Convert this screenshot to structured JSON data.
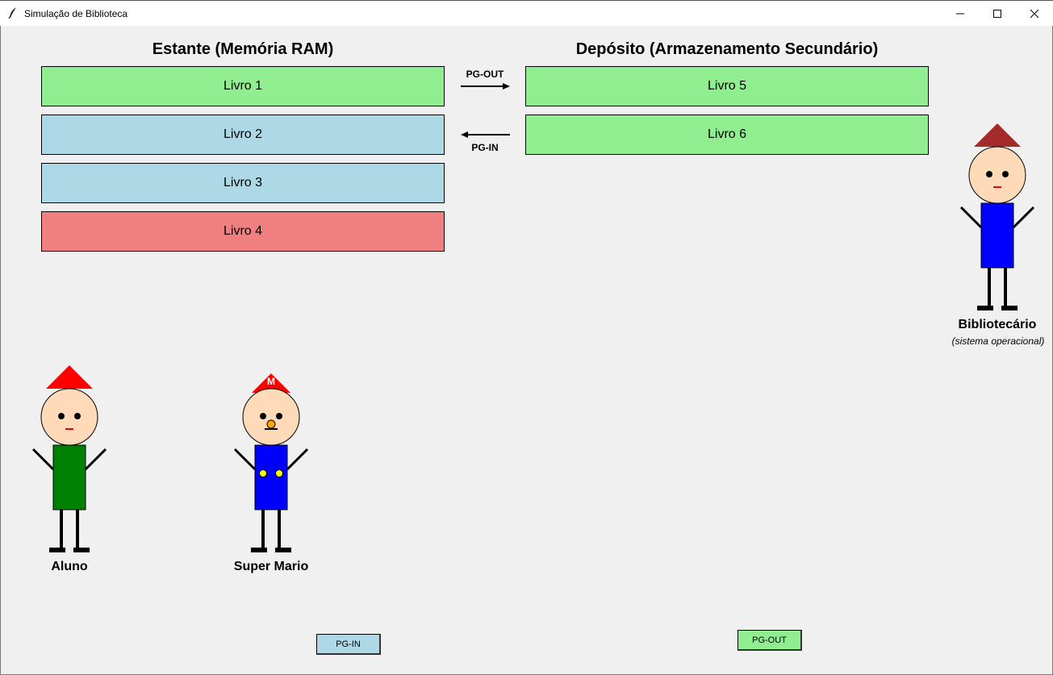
{
  "window": {
    "title": "Simulação de Biblioteca"
  },
  "colors": {
    "active": "#90ee90",
    "loaded": "#add8e6",
    "victim": "#f08080"
  },
  "shelf": {
    "title": "Estante (Memória RAM)",
    "books": [
      {
        "label": "Livro 1",
        "color": "#90ee90"
      },
      {
        "label": "Livro 2",
        "color": "#add8e6"
      },
      {
        "label": "Livro 3",
        "color": "#add8e6"
      },
      {
        "label": "Livro 4",
        "color": "#f08080"
      }
    ]
  },
  "storage": {
    "title": "Depósito (Armazenamento Secundário)",
    "books": [
      {
        "label": "Livro 5",
        "color": "#90ee90"
      },
      {
        "label": "Livro 6",
        "color": "#90ee90"
      }
    ]
  },
  "arrows": {
    "out_label": "PG-OUT",
    "in_label": "PG-IN"
  },
  "characters": {
    "librarian": {
      "name": "Bibliotecário",
      "subtitle": "(sistema operacional)"
    },
    "student": {
      "name": "Aluno"
    },
    "mario": {
      "name": "Super Mario",
      "hat_letter": "M"
    }
  },
  "buttons": {
    "pg_in": "PG-IN",
    "pg_out": "PG-OUT"
  }
}
